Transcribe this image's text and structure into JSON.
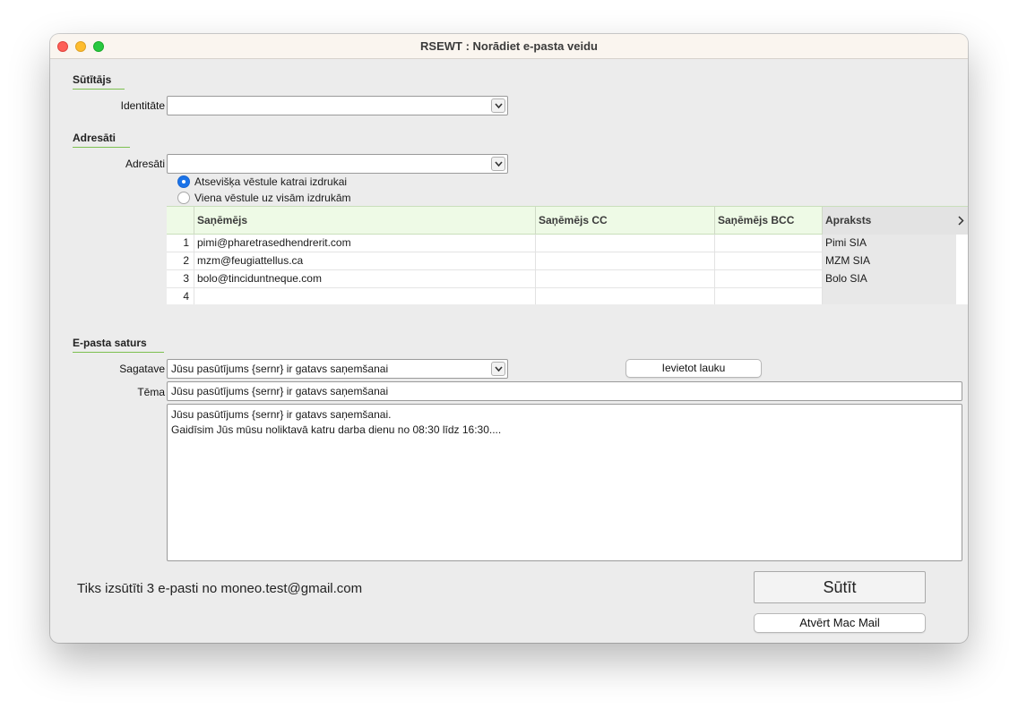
{
  "window": {
    "title": "RSEWT : Norādiet e-pasta veidu"
  },
  "sender": {
    "section_label": "Sūtītājs",
    "identity_label": "Identitāte",
    "identity_value": ""
  },
  "recipients": {
    "section_label": "Adresāti",
    "field_label": "Adresāti",
    "field_value": "",
    "radio_options": [
      {
        "label": "Atsevišķa vēstule katrai izdrukai",
        "selected": true
      },
      {
        "label": "Viena vēstule uz visām izdrukām",
        "selected": false
      }
    ],
    "table": {
      "columns": [
        "Saņēmējs",
        "Saņēmējs CC",
        "Saņēmējs BCC",
        "Apraksts"
      ],
      "more_icon": "chevron-right-icon",
      "rows": [
        {
          "num": "1",
          "to": "pimi@pharetrasedhendrerit.com",
          "cc": "",
          "bcc": "",
          "desc": "Pimi SIA"
        },
        {
          "num": "2",
          "to": "mzm@feugiattellus.ca",
          "cc": "",
          "bcc": "",
          "desc": "MZM SIA"
        },
        {
          "num": "3",
          "to": "bolo@tinciduntneque.com",
          "cc": "",
          "bcc": "",
          "desc": "Bolo SIA"
        },
        {
          "num": "4",
          "to": "",
          "cc": "",
          "bcc": "",
          "desc": ""
        }
      ]
    }
  },
  "content": {
    "section_label": "E-pasta saturs",
    "template_label": "Sagatave",
    "template_value": "Jūsu pasūtījums {sernr} ir gatavs saņemšanai",
    "insert_field_button": "Ievietot lauku",
    "subject_label": "Tēma",
    "subject_value": "Jūsu pasūtījums {sernr} ir gatavs saņemšanai",
    "body_lines": [
      "Jūsu pasūtījums {sernr} ir gatavs saņemšanai.",
      "Gaidīsim Jūs mūsu noliktavā katru darba dienu no 08:30 līdz 16:30...."
    ]
  },
  "footer": {
    "status_text": "Tiks izsūtīti 3 e-pasti no moneo.test@gmail.com",
    "send_button": "Sūtīt",
    "open_mail_button": "Atvērt Mac Mail"
  },
  "colors": {
    "section_underline": "#7cc04f",
    "table_header_bg": "#eefae6",
    "radio_selected": "#1a73e8"
  }
}
